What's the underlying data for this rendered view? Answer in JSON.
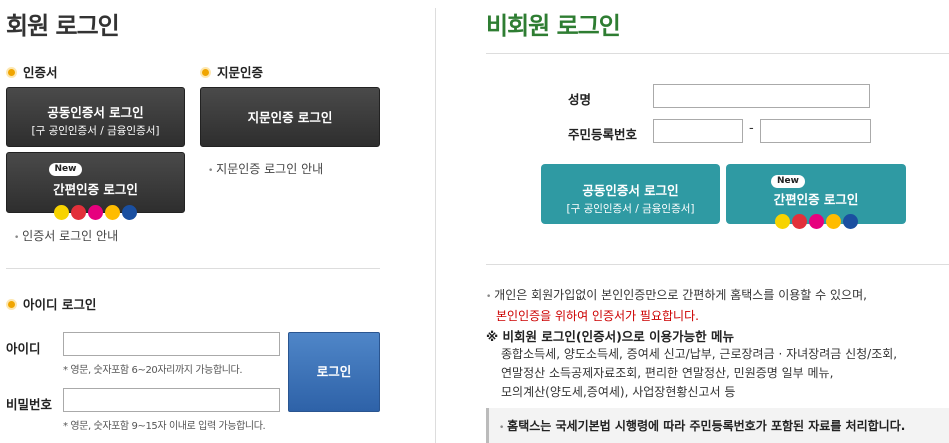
{
  "member": {
    "title": "회원 로그인",
    "cert_section": "인증서",
    "finger_section": "지문인증",
    "joint_cert_btn": {
      "title": "공동인증서 로그인",
      "sub": "[구 공인인증서 / 금융인증서]"
    },
    "simple_cert_btn": {
      "badge": "New",
      "title": "간편인증 로그인"
    },
    "finger_btn": "지문인증 로그인",
    "finger_guide": "지문인증 로그인 안내",
    "cert_guide": "인증서 로그인 안내",
    "id_section": "아이디 로그인",
    "id_label": "아이디",
    "id_hint": "* 영문, 숫자포함 6~20자리까지 가능합니다.",
    "pw_label": "비밀번호",
    "pw_hint": "* 영문, 숫자포함 9~15자 이내로 입력 가능합니다.",
    "login_btn": "로그인"
  },
  "guest": {
    "title": "비회원 로그인",
    "name_label": "성명",
    "rrn_label": "주민등록번호",
    "rrn_dash": "-",
    "joint_cert_btn": {
      "title": "공동인증서 로그인",
      "sub": "[구 공인인증서 / 금융인증서]"
    },
    "simple_cert_btn": {
      "badge": "New",
      "title": "간편인증 로그인"
    },
    "notice_line1": "개인은 회원가입없이 본인인증만으로 간편하게 홈택스를 이용할 수 있으며,",
    "notice_line2": "본인인증을 위하여 인증서가 필요합니다.",
    "menu_title": "※ 비회원 로그인(인증서)으로 이용가능한 메뉴",
    "menu_line1": "종합소득세, 양도소득세, 증여세 신고/납부, 근로장려금 · 자녀장려금 신청/조회,",
    "menu_line2": "연말정산 소득공제자료조회, 편리한 연말정산, 민원증명 일부 메뉴,",
    "menu_line3": "모의계산(양도세,증여세), 사업장현황신고서 등",
    "box_text": "홈택스는 국세기본법 시행령에 따라 주민등록번호가 포함된 자료를 처리합니다."
  },
  "simple_auth_icons": [
    {
      "name": "kakao-icon",
      "color": "#f7d300"
    },
    {
      "name": "payco-icon",
      "color": "#e2303a"
    },
    {
      "name": "pass-icon",
      "color": "#e6007e"
    },
    {
      "name": "kb-icon",
      "color": "#ffbc00"
    },
    {
      "name": "naver-icon",
      "color": "#1a4fa0"
    }
  ]
}
